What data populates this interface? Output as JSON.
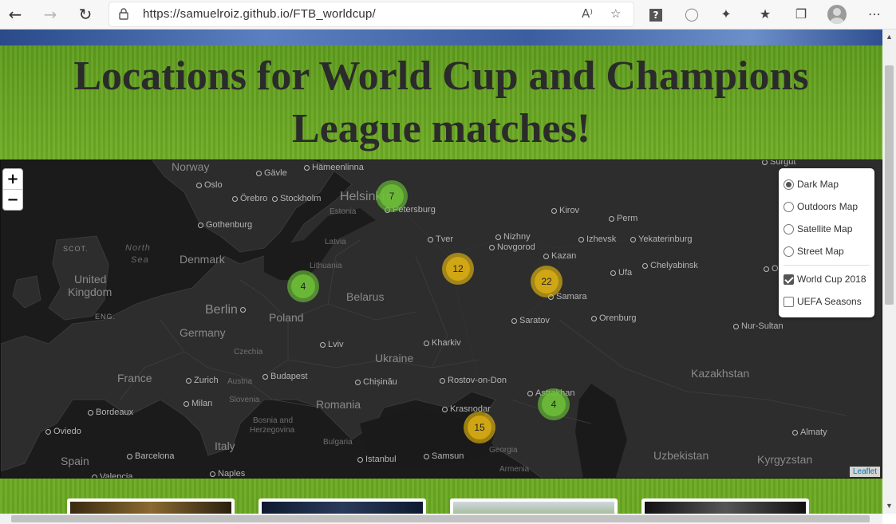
{
  "browser": {
    "url": "https://samuelroiz.github.io/FTB_worldcup/",
    "reader_icon": "A⁾",
    "help_icon": "?"
  },
  "page": {
    "title": "Locations for World Cup and Champions League matches!"
  },
  "map": {
    "zoom_in": "+",
    "zoom_out": "−",
    "attribution": "Leaflet",
    "base_layers": [
      {
        "label": "Dark Map",
        "selected": true
      },
      {
        "label": "Outdoors Map",
        "selected": false
      },
      {
        "label": "Satellite Map",
        "selected": false
      },
      {
        "label": "Street Map",
        "selected": false
      }
    ],
    "overlays": [
      {
        "label": "World Cup 2018",
        "checked": true
      },
      {
        "label": "UEFA Seasons",
        "checked": false
      }
    ],
    "clusters": [
      {
        "count": "7",
        "color": "green"
      },
      {
        "count": "4",
        "color": "green"
      },
      {
        "count": "12",
        "color": "yellow"
      },
      {
        "count": "22",
        "color": "yellow"
      },
      {
        "count": "4",
        "color": "green"
      },
      {
        "count": "15",
        "color": "yellow"
      }
    ],
    "labels": {
      "norway": "Norway",
      "gavle": "Gävle",
      "hameenlinna": "Hämeenlinna",
      "surgut": "Surgut",
      "oslo": "Oslo",
      "orebro": "Örebro",
      "stockholm": "Stockholm",
      "helsinki": "Helsinki",
      "petersburg": "Petersburg",
      "estonia": "Estonia",
      "kirov": "Kirov",
      "perm": "Perm",
      "gothenburg": "Gothenburg",
      "tver": "Tver",
      "nizhny": "Nizhny",
      "novgorod": "Novgorod",
      "izhevsk": "Izhevsk",
      "yekaterinburg": "Yekaterinburg",
      "scot": "SCOT.",
      "north": "North",
      "sea": "Sea",
      "latvia": "Latvia",
      "denmark": "Denmark",
      "lithuania": "Lithuania",
      "kazan": "Kazan",
      "chelyabinsk": "Chelyabinsk",
      "oms": "Oms",
      "united": "United",
      "kingdom": "Kingdom",
      "ufa": "Ufa",
      "belarus": "Belarus",
      "samara": "Samara",
      "berlin": "Berlin",
      "eng": "ENG.",
      "poland": "Poland",
      "orenburg": "Orenburg",
      "saratov": "Saratov",
      "nursultan": "Nur-Sultan",
      "germany": "Germany",
      "czechia": "Czechia",
      "lviv": "Lviv",
      "kharkiv": "Kharkiv",
      "ukraine": "Ukraine",
      "france": "France",
      "zurich": "Zurich",
      "austria": "Austria",
      "budapest": "Budapest",
      "chisinau": "Chișinău",
      "rostov": "Rostov-on-Don",
      "kazakhstan": "Kazakhstan",
      "bordeaux": "Bordeaux",
      "milan": "Milan",
      "slovenia": "Slovenia",
      "romania": "Romania",
      "astrakhan": "Astrakhan",
      "krasnodar": "Krasnodar",
      "bosnia": "Bosnia and",
      "herzegovina": "Herzegovina",
      "oviedo": "Oviedo",
      "bulgaria": "Bulgaria",
      "almaty": "Almaty",
      "italy": "Italy",
      "georgia": "Georgia",
      "spain": "Spain",
      "barcelona": "Barcelona",
      "istanbul": "Istanbul",
      "samsun": "Samsun",
      "uzbekistan": "Uzbekistan",
      "kyrgyzstan": "Kyrgyzstan",
      "armenia": "Armenia",
      "valencia": "Valencia",
      "naples": "Naples"
    }
  },
  "colors": {
    "map_bg": "#252525",
    "land": "#2b2b2b",
    "water": "#1a1a1a",
    "cluster_green": "#6ecc39",
    "cluster_yellow": "#f0c20c",
    "grass": "#78b62a"
  }
}
